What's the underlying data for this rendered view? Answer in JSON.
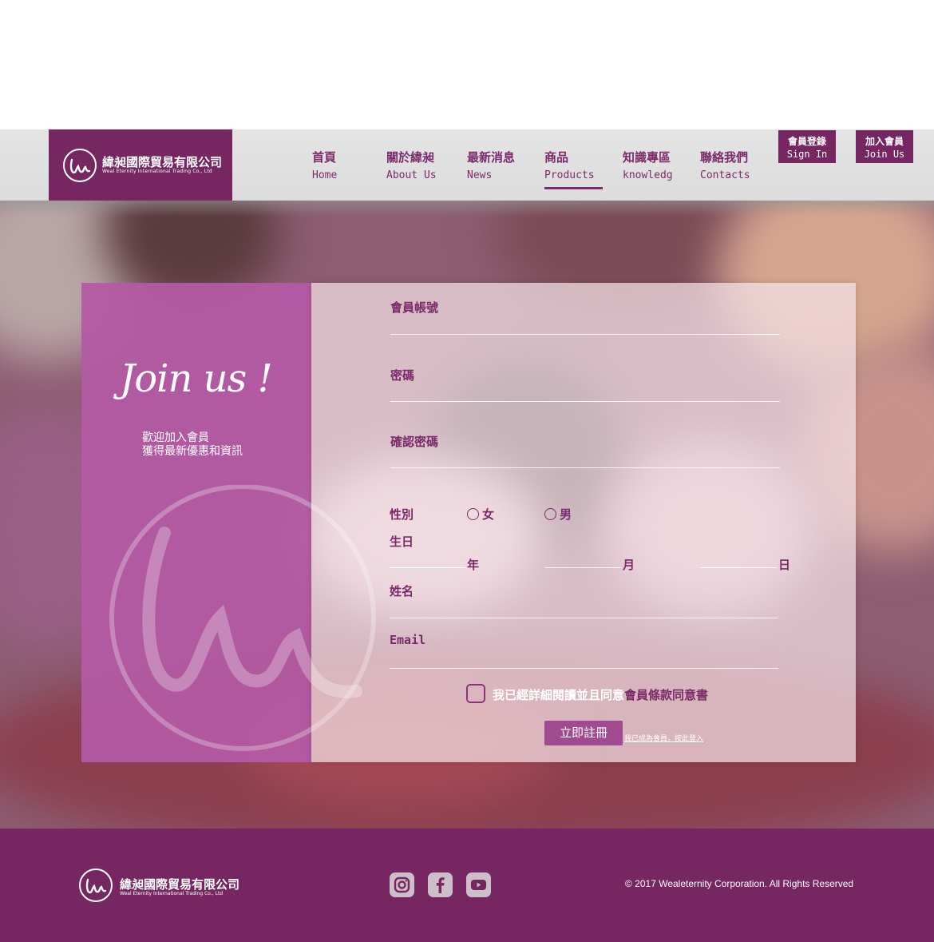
{
  "brand": {
    "name": "緯昶國際貿易有限公司",
    "tagline": "Weal Eternity International Trading Co., Ltd",
    "color": "#762661"
  },
  "nav": [
    {
      "zh": "首頁",
      "en": "Home"
    },
    {
      "zh": "關於緯昶",
      "en": "About Us"
    },
    {
      "zh": "最新消息",
      "en": "News"
    },
    {
      "zh": "商品",
      "en": "Products",
      "active": true
    },
    {
      "zh": "知識專區",
      "en": "knowledg"
    },
    {
      "zh": "聯絡我們",
      "en": "Contacts"
    }
  ],
  "top_buttons": {
    "signin": {
      "zh": "會員登錄",
      "en": "Sign In"
    },
    "join": {
      "zh": "加入會員",
      "en": "Join Us"
    }
  },
  "panel": {
    "title": "Join us !",
    "welcome_line1": "歡迎加入會員",
    "welcome_line2": "獲得最新優惠和資訊"
  },
  "form": {
    "account_label": "會員帳號",
    "password_label": "密碼",
    "confirm_label": "確認密碼",
    "gender_label": "性別",
    "gender_female": "女",
    "gender_male": "男",
    "birthday_label": "生日",
    "year_unit": "年",
    "month_unit": "月",
    "day_unit": "日",
    "name_label": "姓名",
    "email_label": "Email",
    "agree_text": "我已經詳細閱讀並且同意",
    "agree_link": "會員條款同意書",
    "submit": "立即註冊",
    "login_link": "我已成為會員，按此登入"
  },
  "footer": {
    "social_icons": [
      "instagram-icon",
      "facebook-icon",
      "youtube-icon"
    ],
    "copyright": "© 2017 Wealeternity Corporation. All Rights Reserved"
  }
}
